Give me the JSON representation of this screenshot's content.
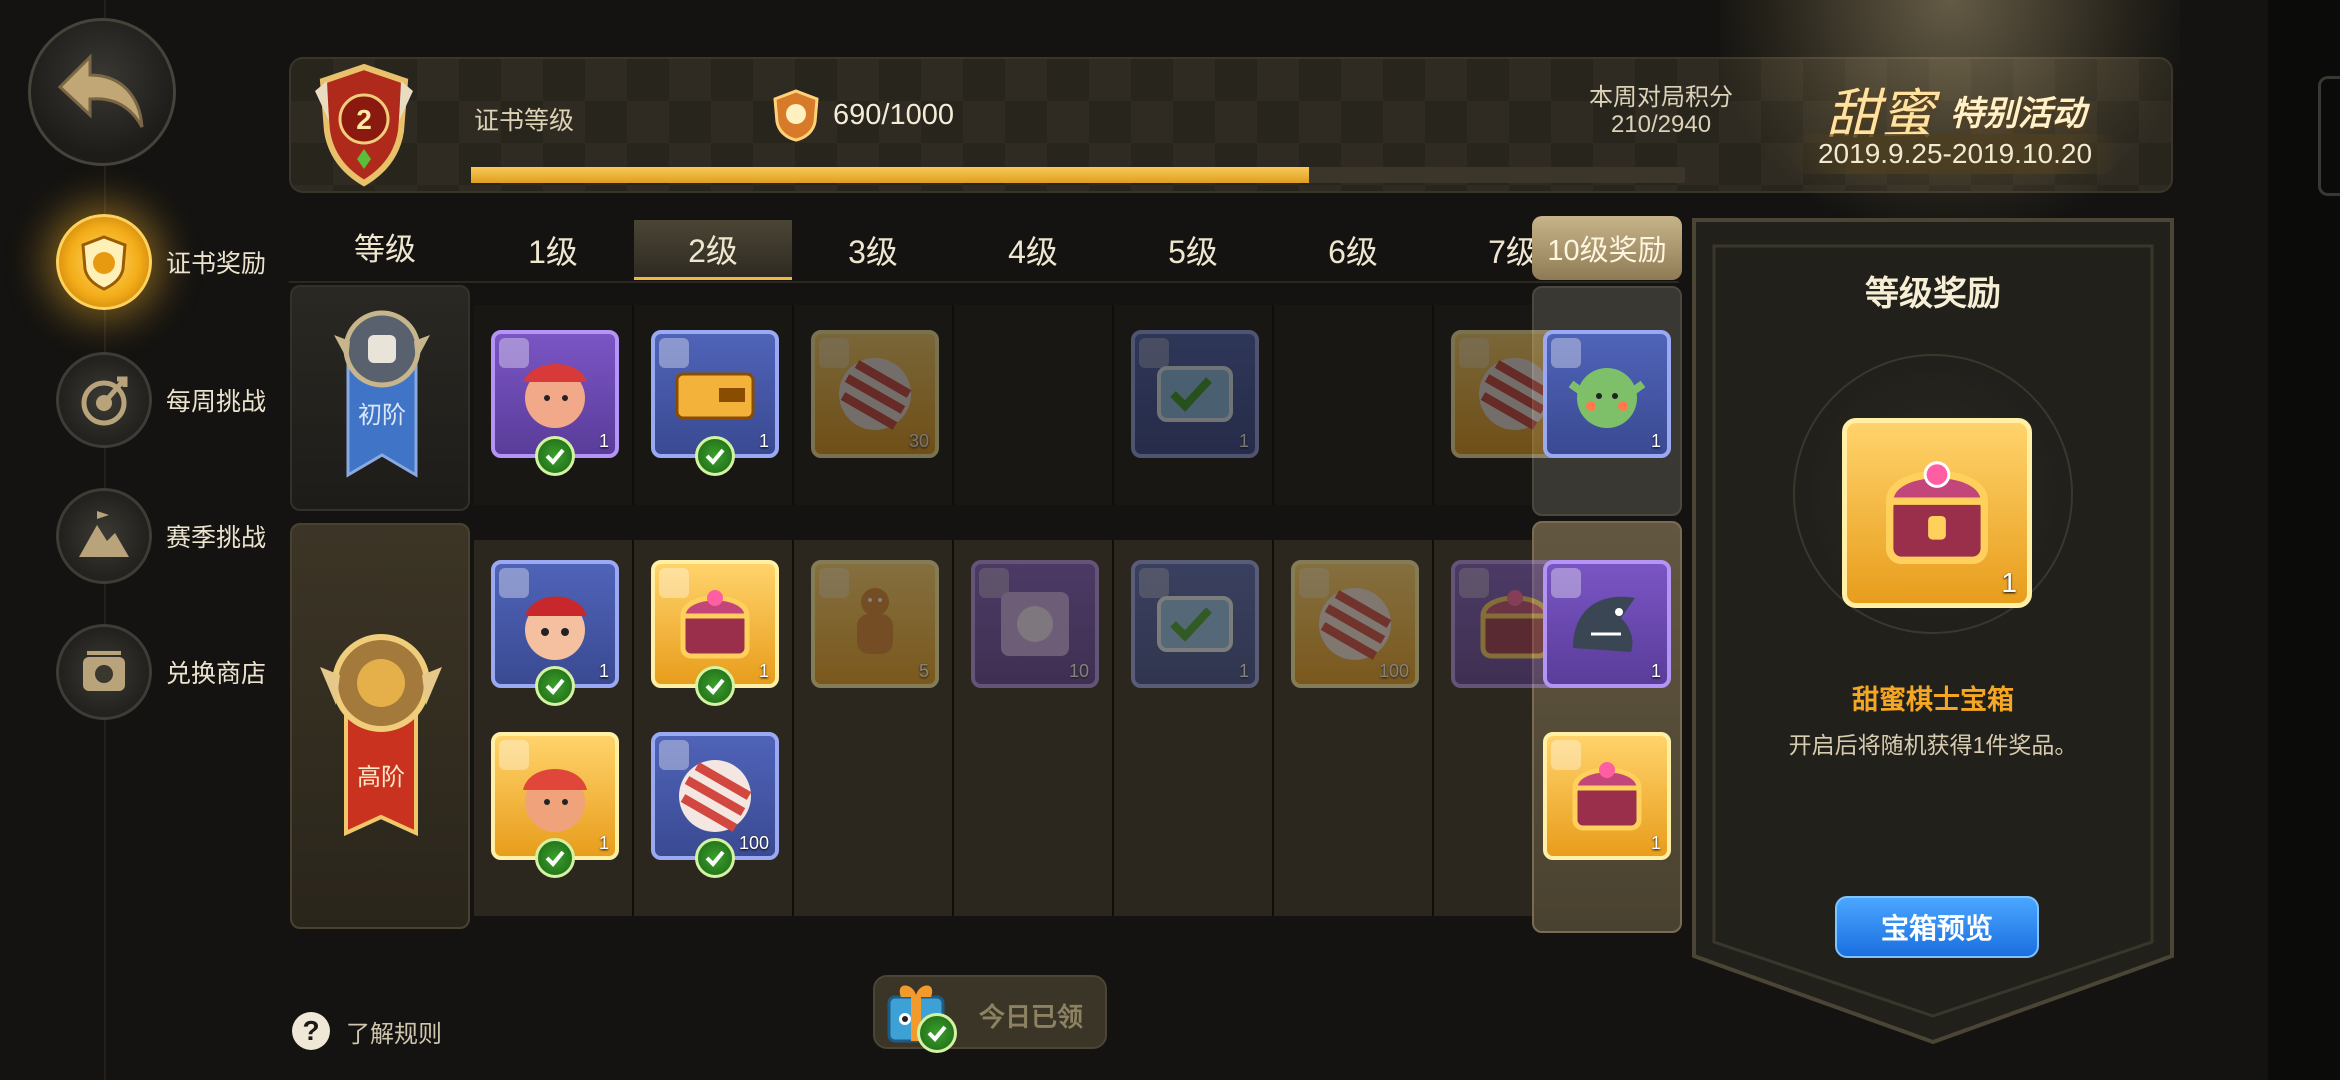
{
  "navigation": {
    "back_icon": "back-arrow-icon",
    "items": [
      {
        "label": "证书奖励",
        "icon": "shield-crest-icon",
        "active": true
      },
      {
        "label": "每周挑战",
        "icon": "target-arrow-icon",
        "active": false
      },
      {
        "label": "赛季挑战",
        "icon": "mountain-flag-icon",
        "active": false
      },
      {
        "label": "兑换商店",
        "icon": "shop-icon",
        "active": false
      }
    ]
  },
  "header": {
    "certificate_level": "2",
    "certificate_label": "证书等级",
    "score": "690/1000",
    "progress_fraction": 0.69,
    "weekly_score_title": "本周对局积分",
    "weekly_score_value": "210/2940",
    "event": {
      "title_main": "甜蜜",
      "title_sub": "特别活动",
      "dates": "2019.9.25-2019.10.20"
    }
  },
  "grid": {
    "tier_header": "等级",
    "levels": [
      "1级",
      "2级",
      "3级",
      "4级",
      "5级",
      "6级",
      "7级"
    ],
    "active_level_index": 1,
    "level10_tab": "10级奖励",
    "tiers": [
      {
        "name": "初阶",
        "icon": "helmet-skull-icon"
      },
      {
        "name": "高阶",
        "icon": "golden-crown-helmet-icon"
      }
    ],
    "basic_rewards": [
      {
        "level": "1级",
        "icon": "pirate-avatar-icon",
        "qty": "1",
        "rarity": "purple",
        "claimed": true
      },
      {
        "level": "2级",
        "icon": "ticket-card-icon",
        "qty": "1",
        "rarity": "blue",
        "claimed": true
      },
      {
        "level": "3级",
        "icon": "candy-icon",
        "qty": "30",
        "rarity": "gold",
        "claimed": false
      },
      {
        "level": "5级",
        "icon": "voucher-card-icon",
        "qty": "1",
        "rarity": "blue",
        "claimed": false
      },
      {
        "level": "7级",
        "icon": "candy-icon",
        "qty": "",
        "rarity": "gold",
        "claimed": false
      },
      {
        "level": "10级奖励",
        "icon": "green-goblin-avatar-icon",
        "qty": "1",
        "rarity": "blue",
        "claimed": false
      }
    ],
    "advanced_rewards_row1": [
      {
        "level": "1级",
        "icon": "bandana-kid-avatar-icon",
        "qty": "1",
        "rarity": "blue",
        "claimed": true
      },
      {
        "level": "2级",
        "icon": "treasure-chest-icon",
        "qty": "1",
        "rarity": "gold",
        "claimed": true
      },
      {
        "level": "3级",
        "icon": "gingerbread-icon",
        "qty": "5",
        "rarity": "gold",
        "claimed": false
      },
      {
        "level": "4级",
        "icon": "emote-card-icon",
        "qty": "10",
        "rarity": "purple",
        "claimed": false
      },
      {
        "level": "5级",
        "icon": "voucher-card-icon",
        "qty": "1",
        "rarity": "blue",
        "claimed": false
      },
      {
        "level": "6级",
        "icon": "candy-icon",
        "qty": "100",
        "rarity": "gold",
        "claimed": false
      },
      {
        "level": "7级",
        "icon": "treasure-chest-icon",
        "qty": "",
        "rarity": "purple",
        "claimed": false
      },
      {
        "level": "10级奖励",
        "icon": "shark-avatar-icon",
        "qty": "1",
        "rarity": "purple",
        "claimed": false
      }
    ],
    "advanced_rewards_row2": [
      {
        "level": "1级",
        "icon": "warrior-girl-avatar-icon",
        "qty": "1",
        "rarity": "gold",
        "claimed": true
      },
      {
        "level": "2级",
        "icon": "candy-icon",
        "qty": "100",
        "rarity": "blue",
        "claimed": true
      },
      {
        "level": "10级奖励",
        "icon": "treasure-chest-icon",
        "qty": "1",
        "rarity": "gold",
        "claimed": false
      }
    ]
  },
  "detail": {
    "title": "等级奖励",
    "item_icon": "treasure-chest-icon",
    "item_qty": "1",
    "item_name": "甜蜜棋士宝箱",
    "item_desc": "开启后将随机获得1件奖品。",
    "preview_button": "宝箱预览"
  },
  "footer": {
    "rules_label": "了解规则",
    "daily_label": "今日已领"
  },
  "colors": {
    "accent_gold": "#f5a623",
    "progress": "#f0b432",
    "blue_button": "#1b6fe0",
    "claimed_check": "#3aa12b"
  }
}
